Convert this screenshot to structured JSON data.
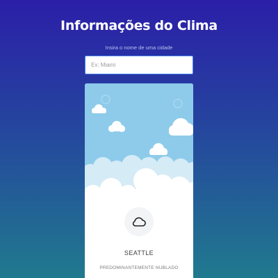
{
  "header": {
    "title": "Informações do Clima",
    "search_label": "Insira o nome de uma cidade"
  },
  "search": {
    "value": "",
    "placeholder": "Ex: Miami"
  },
  "weather_card": {
    "city": "SEATTLE",
    "description": "PREDOMINANTEMENTE NUBLADO",
    "weather_icon": "cloud-icon",
    "scene": "sky-with-clouds"
  },
  "colors": {
    "background_top": "#2b1ea8",
    "background_bottom": "#207a8e",
    "sky": "#8ecbea",
    "input_border": "#4a86f0"
  }
}
